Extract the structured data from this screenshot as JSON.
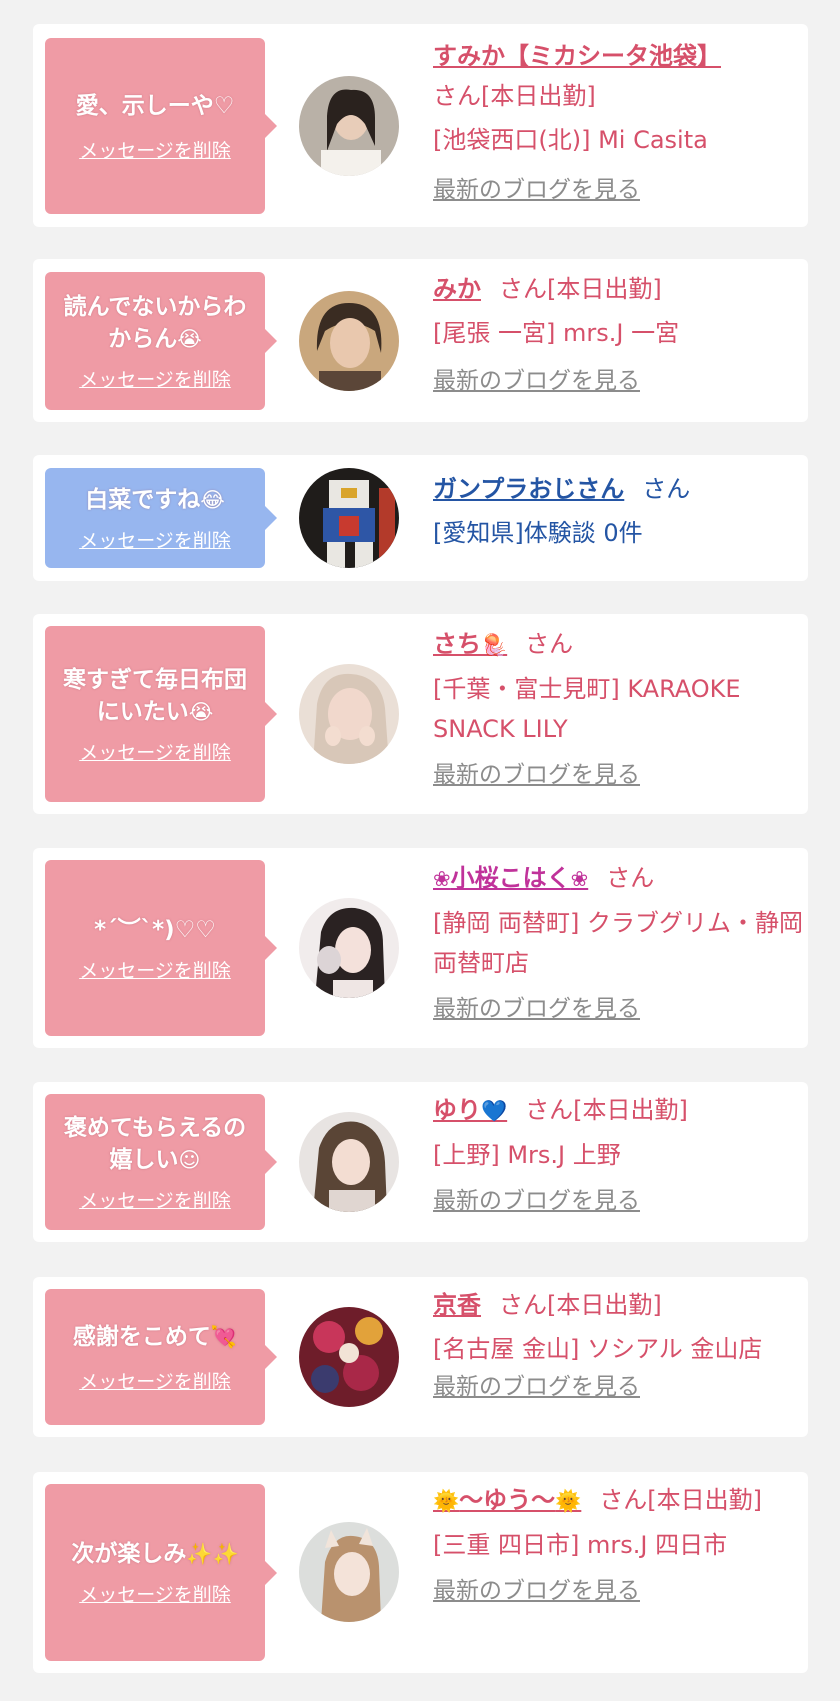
{
  "delete_label": "メッセージを削除",
  "blog_label": "最新のブログを見る",
  "colors": {
    "pink_bubble": "#ef9ba5",
    "blue_bubble": "#97b6ef",
    "pink_text": "#d6506a",
    "blue_text": "#2455a4"
  },
  "items": [
    {
      "message": "愛、示しーや♡",
      "name": "すみか【ミカシータ池袋】",
      "suffix": "さん[本日出勤]",
      "shop": "[池袋西口(北)] Mi Casita",
      "blog": true
    },
    {
      "message": "読んでないからわからん",
      "message_emoji": "😭",
      "name": "みか",
      "suffix": "さん[本日出勤]",
      "shop": "[尾張 一宮] mrs.J 一宮",
      "blog": true
    },
    {
      "message": "白菜ですね",
      "message_emoji": "😂",
      "name": "ガンプラおじさん",
      "suffix": "さん",
      "shop": "[愛知県]体験談 0件",
      "blog": false
    },
    {
      "message": "寒すぎて毎日布団にいたい",
      "message_emoji": "😭",
      "name": "さち",
      "name_emoji": "🪼",
      "suffix": "さん",
      "shop": "[千葉・富士見町] KARAOKE SNACK LILY",
      "blog": true
    },
    {
      "message": "*´︶`*)♡♡",
      "name": "小桜こはく",
      "name_emoji_left": "❀",
      "name_emoji_right": "❀",
      "suffix": "さん",
      "shop": "[静岡 両替町] クラブグリム・静岡両替町店",
      "blog": true
    },
    {
      "message": "褒めてもらえるの嬉しい",
      "message_emoji": "☺",
      "name": "ゆり",
      "name_emoji": "💙",
      "suffix": "さん[本日出勤]",
      "shop": "[上野] Mrs.J 上野",
      "blog": true
    },
    {
      "message": "感謝をこめて",
      "message_emoji": "💘",
      "name": "京香",
      "suffix": "さん[本日出勤]",
      "shop": "[名古屋 金山] ソシアル 金山店",
      "blog": true
    },
    {
      "message": "次が楽しみ",
      "message_emoji": "✨✨",
      "name": "〜ゆう〜",
      "name_emoji_left": "🌞",
      "name_emoji_right": "🌞",
      "suffix": "さん[本日出勤]",
      "shop": "[三重 四日市] mrs.J 四日市",
      "blog": true
    }
  ]
}
